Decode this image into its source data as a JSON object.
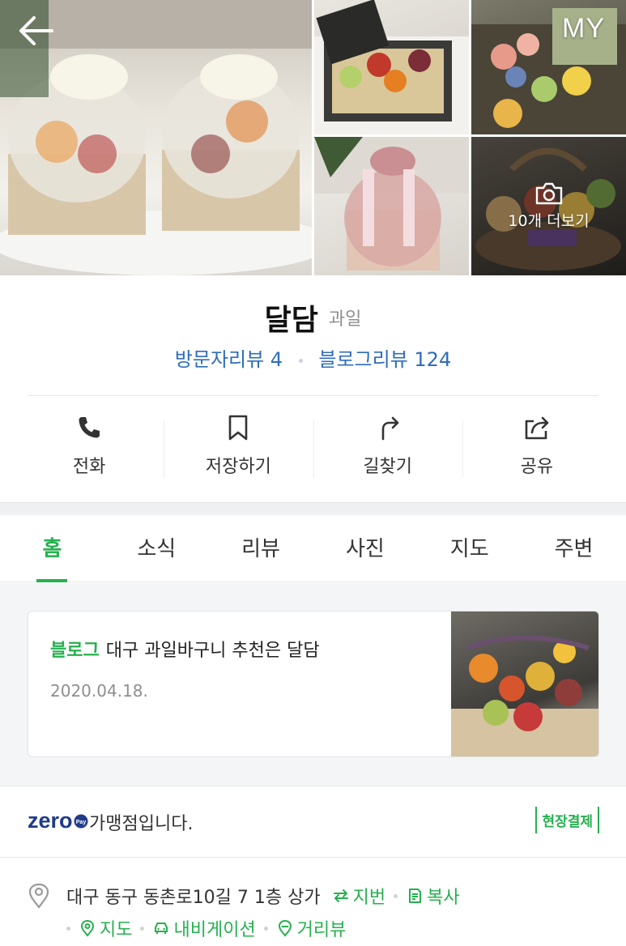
{
  "nav": {
    "back_icon": "arrow-left-icon",
    "my_label": "MY"
  },
  "gallery": {
    "more_label": "10개 더보기",
    "camera_icon": "camera-icon"
  },
  "place": {
    "name": "달담",
    "category": "과일"
  },
  "reviews": {
    "visitor": "방문자리뷰 4",
    "blog": "블로그리뷰 124"
  },
  "actions": [
    {
      "label": "전화",
      "icon": "phone-icon"
    },
    {
      "label": "저장하기",
      "icon": "bookmark-icon"
    },
    {
      "label": "길찾기",
      "icon": "directions-icon"
    },
    {
      "label": "공유",
      "icon": "share-icon"
    }
  ],
  "tabs": [
    "홈",
    "소식",
    "리뷰",
    "사진",
    "지도",
    "주변"
  ],
  "active_tab": "홈",
  "blog_card": {
    "tag": "블로그",
    "title": "대구 과일바구니 추천은 달담",
    "date": "2020.04.18."
  },
  "zeropay": {
    "logo": "zero",
    "logo_badge": "Pay",
    "text": "가맹점입니다.",
    "badge": "현장결제"
  },
  "address": {
    "text": "대구 동구 동촌로10길 7 1층 상가",
    "jibun": "지번",
    "copy": "복사",
    "map": "지도",
    "navigation": "내비게이션",
    "distance": "거리뷰"
  },
  "colors": {
    "accent_green": "#26b04f",
    "link_blue": "#2f6dbb",
    "zero_navy": "#213b8a"
  }
}
